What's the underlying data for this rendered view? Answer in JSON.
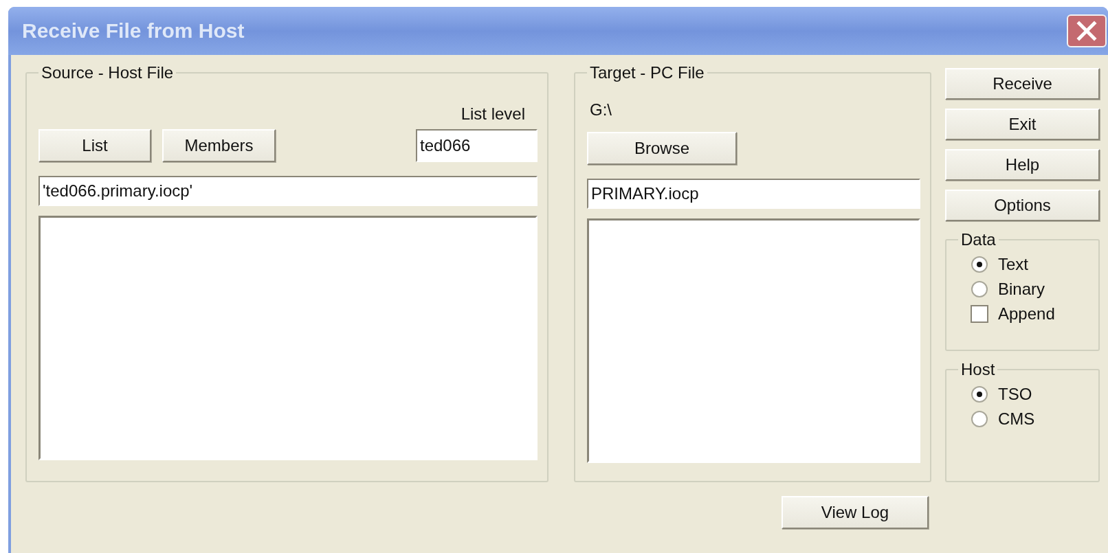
{
  "window": {
    "title": "Receive File from Host"
  },
  "source": {
    "legend": "Source - Host File",
    "list_level_label": "List level",
    "buttons": [
      "List",
      "Members"
    ],
    "list_level_value": "ted066",
    "host_file_value": "'ted066.primary.iocp'"
  },
  "target": {
    "legend": "Target - PC File",
    "path": "G:\\",
    "browse_button": "Browse",
    "pc_file_value": "PRIMARY.iocp"
  },
  "actions": [
    "Receive",
    "Exit",
    "Help",
    "Options"
  ],
  "data_group": {
    "legend": "Data",
    "options": [
      {
        "kind": "radio",
        "label": "Text",
        "selected": true
      },
      {
        "kind": "radio",
        "label": "Binary",
        "selected": false
      },
      {
        "kind": "checkbox",
        "label": "Append",
        "checked": false
      }
    ]
  },
  "host_group": {
    "legend": "Host",
    "options": [
      {
        "kind": "radio",
        "label": "TSO",
        "selected": true
      },
      {
        "kind": "radio",
        "label": "CMS",
        "selected": false
      }
    ]
  },
  "view_log_button": "View Log"
}
